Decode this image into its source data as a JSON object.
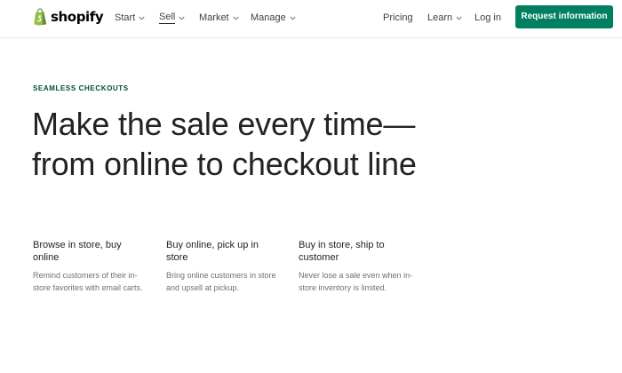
{
  "header": {
    "logo_text": "shopify",
    "nav": [
      {
        "label": "Start",
        "has_menu": true
      },
      {
        "label": "Sell",
        "has_menu": true,
        "active": true
      },
      {
        "label": "Market",
        "has_menu": true
      },
      {
        "label": "Manage",
        "has_menu": true
      }
    ],
    "right_nav": [
      {
        "label": "Pricing",
        "has_menu": false
      },
      {
        "label": "Learn",
        "has_menu": true
      },
      {
        "label": "Log in",
        "has_menu": false
      }
    ],
    "cta_label": "Request information"
  },
  "hero": {
    "eyebrow": "SEAMLESS CHECKOUTS",
    "headline": "Make the sale every time—from online to checkout line"
  },
  "features": [
    {
      "title": "Browse in store, buy online",
      "description": "Remind customers of their in-store favorites with email carts."
    },
    {
      "title": "Buy online, pick up in store",
      "description": "Bring online customers in store and upsell at pickup."
    },
    {
      "title": "Buy in store, ship to customer",
      "description": "Never lose a sale even when in-store inventory is limited."
    }
  ],
  "colors": {
    "brand_green": "#008060",
    "logo_green": "#95bf47",
    "eyebrow": "#004c3f",
    "text": "#212326",
    "muted_text": "#6d7175"
  },
  "icons": {
    "logo": "shopify-bag-icon",
    "menu": "chevron-down-icon"
  }
}
